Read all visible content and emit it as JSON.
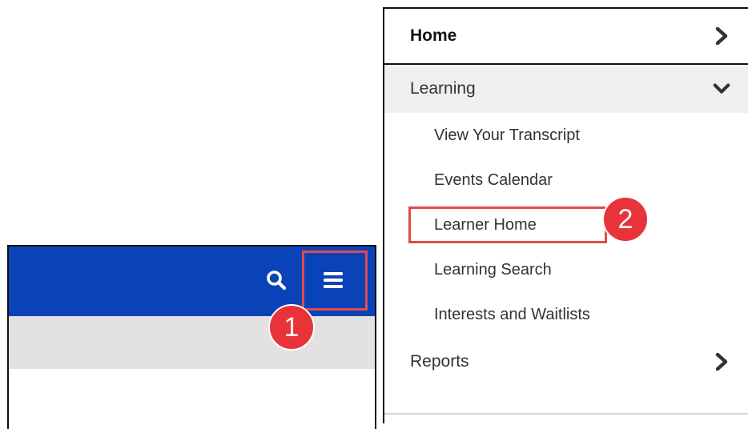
{
  "left_panel": {
    "topbar_color": "#0a43b8",
    "subbar_color": "#e2e2e2",
    "search_icon": "search-icon",
    "menu_icon": "hamburger-menu-icon"
  },
  "callouts": {
    "one": "1",
    "two": "2",
    "color": "#e8333a",
    "highlight_color": "#e24a4a"
  },
  "menu": {
    "home": {
      "label": "Home",
      "icon": "chevron-right-icon"
    },
    "learning": {
      "label": "Learning",
      "icon": "chevron-down-icon",
      "items": [
        {
          "label": "View Your Transcript"
        },
        {
          "label": "Events Calendar"
        },
        {
          "label": "Learner Home"
        },
        {
          "label": "Learning Search"
        },
        {
          "label": "Interests and Waitlists"
        }
      ]
    },
    "reports": {
      "label": "Reports",
      "icon": "chevron-right-icon"
    }
  }
}
